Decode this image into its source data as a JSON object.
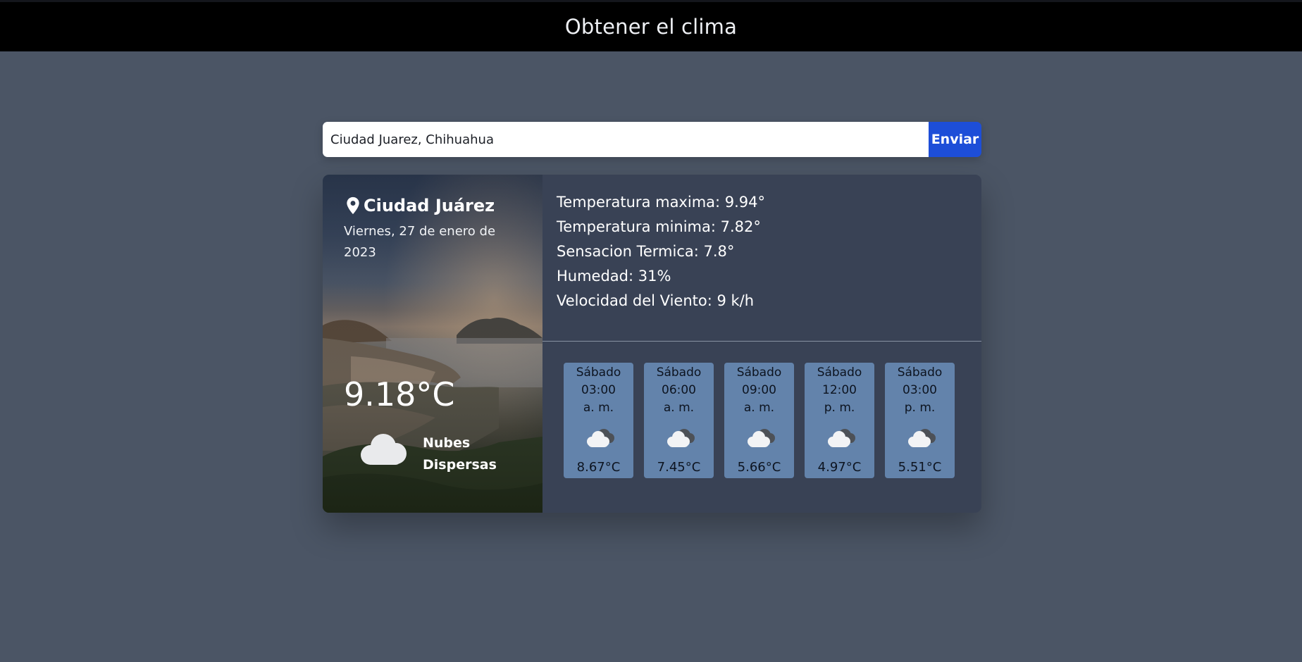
{
  "header": {
    "title": "Obtener el clima"
  },
  "search": {
    "value": "Ciudad Juarez, Chihuahua",
    "button_label": "Enviar"
  },
  "current": {
    "city": "Ciudad Juárez",
    "date": "Viernes, 27 de enero de 2023",
    "temperature": "9.18°C",
    "description": "Nubes Dispersas",
    "icon": "cloud-icon"
  },
  "details": {
    "max": "Temperatura maxima: 9.94°",
    "min": "Temperatura minima: 7.82°",
    "feels_like": "Sensacion Termica: 7.8°",
    "humidity": "Humedad: 31%",
    "wind": "Velocidad del Viento: 9 k/h"
  },
  "forecast": [
    {
      "day": "Sábado",
      "time": "03:00",
      "ampm": "a. m.",
      "temp": "8.67°C",
      "icon": "broken-clouds-icon"
    },
    {
      "day": "Sábado",
      "time": "06:00",
      "ampm": "a. m.",
      "temp": "7.45°C",
      "icon": "broken-clouds-icon"
    },
    {
      "day": "Sábado",
      "time": "09:00",
      "ampm": "a. m.",
      "temp": "5.66°C",
      "icon": "broken-clouds-icon"
    },
    {
      "day": "Sábado",
      "time": "12:00",
      "ampm": "p. m.",
      "temp": "4.97°C",
      "icon": "broken-clouds-icon"
    },
    {
      "day": "Sábado",
      "time": "03:00",
      "ampm": "p. m.",
      "temp": "5.51°C",
      "icon": "broken-clouds-icon"
    }
  ],
  "colors": {
    "page_bg": "#4b5565",
    "header_bg": "#000000",
    "button_bg": "#1d4ed8",
    "panel_bg": "#394255",
    "forecast_card_bg": "#6383ab"
  }
}
